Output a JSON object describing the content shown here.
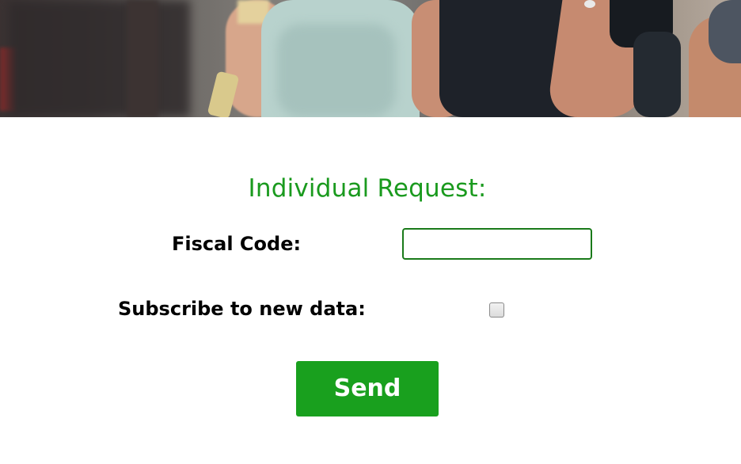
{
  "colors": {
    "accent": "#1a9a1e",
    "button_bg": "#19a01e",
    "button_text": "#ffffff",
    "input_border": "#1a7a1a",
    "label": "#000000"
  },
  "form": {
    "title": "Individual Request:",
    "fiscal_code_label": "Fiscal Code:",
    "fiscal_code_value": "",
    "subscribe_label": "Subscribe to new data:",
    "subscribe_checked": false,
    "send_label": "Send"
  }
}
